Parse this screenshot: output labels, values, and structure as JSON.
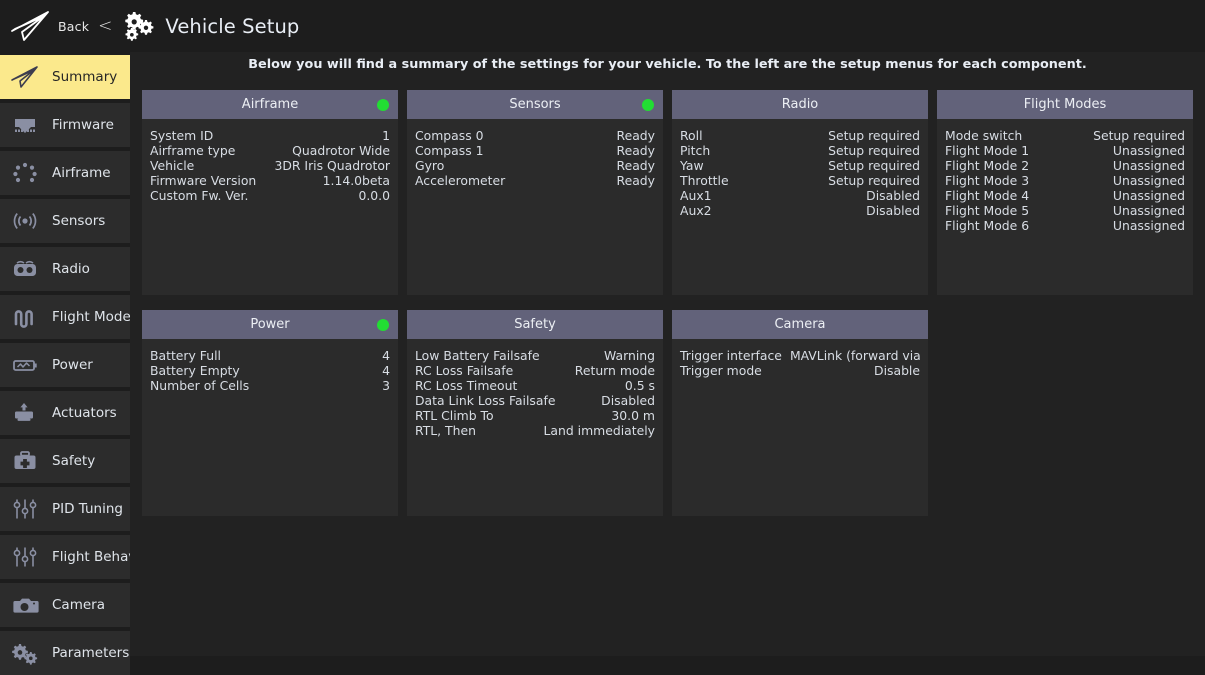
{
  "topbar": {
    "back_label": "Back",
    "back_chevron": "<",
    "title": "Vehicle Setup",
    "logo_icon": "paper-plane-icon",
    "gears_icon": "gears-icon"
  },
  "instruction": "Below you will find a summary of the settings for your vehicle. To the left are the setup menus for each component.",
  "colors": {
    "accent_active": "#fbe98c",
    "panel_header": "#62627a",
    "status_ok": "#22dd33",
    "background": "#222222",
    "sidebar_item": "#2c2c2c"
  },
  "sidebar": {
    "items": [
      {
        "label": "Summary",
        "icon": "paper-plane-icon",
        "active": true
      },
      {
        "label": "Firmware",
        "icon": "firmware-download-icon",
        "active": false
      },
      {
        "label": "Airframe",
        "icon": "airframe-rotor-icon",
        "active": false
      },
      {
        "label": "Sensors",
        "icon": "sensors-signal-icon",
        "active": false
      },
      {
        "label": "Radio",
        "icon": "radio-controller-icon",
        "active": false
      },
      {
        "label": "Flight Modes",
        "icon": "flight-modes-wave-icon",
        "active": false
      },
      {
        "label": "Power",
        "icon": "battery-icon",
        "active": false
      },
      {
        "label": "Actuators",
        "icon": "actuator-motor-icon",
        "active": false
      },
      {
        "label": "Safety",
        "icon": "first-aid-kit-icon",
        "active": false
      },
      {
        "label": "PID Tuning",
        "icon": "sliders-icon",
        "active": false
      },
      {
        "label": "Flight Behavior",
        "icon": "sliders-icon",
        "active": false
      },
      {
        "label": "Camera",
        "icon": "camera-icon",
        "active": false
      },
      {
        "label": "Parameters",
        "icon": "gears-icon",
        "active": false
      }
    ]
  },
  "panels": {
    "row1": [
      {
        "title": "Airframe",
        "status": "ok",
        "rows": [
          {
            "key": "System ID",
            "value": "1"
          },
          {
            "key": "Airframe type",
            "value": "Quadrotor Wide"
          },
          {
            "key": "Vehicle",
            "value": "3DR Iris Quadrotor"
          },
          {
            "key": "Firmware Version",
            "value": "1.14.0beta"
          },
          {
            "key": "Custom Fw. Ver.",
            "value": "0.0.0"
          }
        ]
      },
      {
        "title": "Sensors",
        "status": "ok",
        "rows": [
          {
            "key": "Compass 0",
            "value": "Ready"
          },
          {
            "key": "Compass 1",
            "value": "Ready"
          },
          {
            "key": "Gyro",
            "value": "Ready"
          },
          {
            "key": "Accelerometer",
            "value": "Ready"
          }
        ]
      },
      {
        "title": "Radio",
        "status": "none",
        "rows": [
          {
            "key": "Roll",
            "value": "Setup required"
          },
          {
            "key": "Pitch",
            "value": "Setup required"
          },
          {
            "key": "Yaw",
            "value": "Setup required"
          },
          {
            "key": "Throttle",
            "value": "Setup required"
          },
          {
            "key": "Aux1",
            "value": "Disabled"
          },
          {
            "key": "Aux2",
            "value": "Disabled"
          }
        ]
      },
      {
        "title": "Flight Modes",
        "status": "none",
        "rows": [
          {
            "key": "Mode switch",
            "value": "Setup required"
          },
          {
            "key": "Flight Mode 1",
            "value": "Unassigned"
          },
          {
            "key": "Flight Mode 2",
            "value": "Unassigned"
          },
          {
            "key": "Flight Mode 3",
            "value": "Unassigned"
          },
          {
            "key": "Flight Mode 4",
            "value": "Unassigned"
          },
          {
            "key": "Flight Mode 5",
            "value": "Unassigned"
          },
          {
            "key": "Flight Mode 6",
            "value": "Unassigned"
          }
        ]
      }
    ],
    "row2": [
      {
        "title": "Power",
        "status": "ok",
        "rows": [
          {
            "key": "Battery Full",
            "value": "4"
          },
          {
            "key": "Battery Empty",
            "value": "4"
          },
          {
            "key": "Number of Cells",
            "value": "3"
          }
        ]
      },
      {
        "title": "Safety",
        "status": "none",
        "rows": [
          {
            "key": "Low Battery Failsafe",
            "value": "Warning"
          },
          {
            "key": "RC Loss Failsafe",
            "value": "Return mode"
          },
          {
            "key": "RC Loss Timeout",
            "value": "0.5 s"
          },
          {
            "key": "Data Link Loss Failsafe",
            "value": "Disabled"
          },
          {
            "key": "RTL Climb To",
            "value": "30.0 m"
          },
          {
            "key": "RTL, Then",
            "value": "Land immediately"
          }
        ]
      },
      {
        "title": "Camera",
        "status": "none",
        "rows": [
          {
            "key": "Trigger interface",
            "value": "MAVLink (forward via MAV_..."
          },
          {
            "key": "Trigger mode",
            "value": "Disable"
          }
        ]
      }
    ]
  }
}
